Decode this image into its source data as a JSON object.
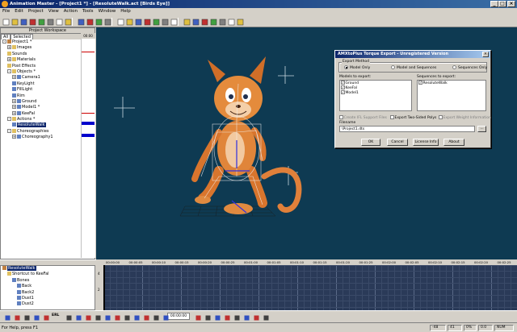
{
  "window": {
    "title": "Animation Master - [Project1 *] - [ResoluteWalk.act [Birds Eye]]"
  },
  "menu": [
    "File",
    "Edit",
    "Project",
    "View",
    "Action",
    "Tools",
    "Window",
    "Help"
  ],
  "workspace": {
    "title": "Project Workspace",
    "tabs": [
      "All",
      "Selected"
    ],
    "tree": [
      {
        "label": "Project1 *",
        "indent": 0,
        "exp": "-"
      },
      {
        "label": "Images",
        "indent": 1,
        "exp": "+"
      },
      {
        "label": "Sounds",
        "indent": 1,
        "exp": ""
      },
      {
        "label": "Materials",
        "indent": 1,
        "exp": "+"
      },
      {
        "label": "Post Effects",
        "indent": 1,
        "exp": ""
      },
      {
        "label": "Objects *",
        "indent": 1,
        "exp": "-"
      },
      {
        "label": "Camera1",
        "indent": 2,
        "exp": "+"
      },
      {
        "label": "KeyLight",
        "indent": 2,
        "exp": ""
      },
      {
        "label": "FillLight",
        "indent": 2,
        "exp": ""
      },
      {
        "label": "Rim",
        "indent": 2,
        "exp": ""
      },
      {
        "label": "Ground",
        "indent": 2,
        "exp": "+"
      },
      {
        "label": "Model1 *",
        "indent": 2,
        "exp": "+"
      },
      {
        "label": "KeeFal",
        "indent": 2,
        "exp": "+"
      },
      {
        "label": "Actions *",
        "indent": 1,
        "exp": "-"
      },
      {
        "label": "ResoluteWalk",
        "indent": 2,
        "exp": "",
        "selected": true
      },
      {
        "label": "Choreographies",
        "indent": 1,
        "exp": "-"
      },
      {
        "label": "Choreography1",
        "indent": 2,
        "exp": "+"
      }
    ],
    "time": "00:00"
  },
  "dialog": {
    "title": "AMXtoPlus Torque Export - Unregistered Version",
    "export_method_label": "Export Method",
    "radios": [
      "Model Only",
      "Model and Sequences",
      "Sequences Only"
    ],
    "selected_radio": 0,
    "models_label": "Models to export:",
    "models": [
      "Ground",
      "KeeFal",
      "Model1"
    ],
    "sequences_label": "Sequences to export:",
    "sequences": [
      "ResoluteWalk"
    ],
    "options": [
      "Create IFL Support Files",
      "Export Two-Sided Polys",
      "Export Weight Information"
    ],
    "filename_label": "Filename",
    "filename": "\\Project1.dts",
    "browse": "...",
    "buttons": [
      "OK",
      "Cancel",
      "License Info",
      "About"
    ]
  },
  "timeline": {
    "tree": [
      {
        "label": "ResoluteWalk",
        "indent": 0,
        "selected": true
      },
      {
        "label": "Shortcut to KeeFal",
        "indent": 1
      },
      {
        "label": "Bones",
        "indent": 2
      },
      {
        "label": "Back",
        "indent": 3
      },
      {
        "label": "Back2",
        "indent": 3
      },
      {
        "label": "Dust1",
        "indent": 3
      },
      {
        "label": "Dust2",
        "indent": 3
      }
    ],
    "ticks": [
      "00:00:00",
      "00:00:05",
      "00:00:10",
      "00:00:15",
      "00:00:20",
      "00:00:25",
      "00:01:00",
      "00:01:05",
      "00:01:10",
      "00:01:15",
      "00:01:20",
      "00:01:25",
      "00:02:00",
      "00:02:05",
      "00:02:10",
      "00:02:15",
      "00:02:20",
      "00:02:25"
    ],
    "vruler": [
      "4",
      "2"
    ],
    "time_field": "00:00:00",
    "erl_label": "ERL"
  },
  "status": {
    "help": "For Help, press F1",
    "x": "-48",
    "y": "41",
    "zoom": "0%",
    "val": "0.0",
    "num": "NUM"
  }
}
